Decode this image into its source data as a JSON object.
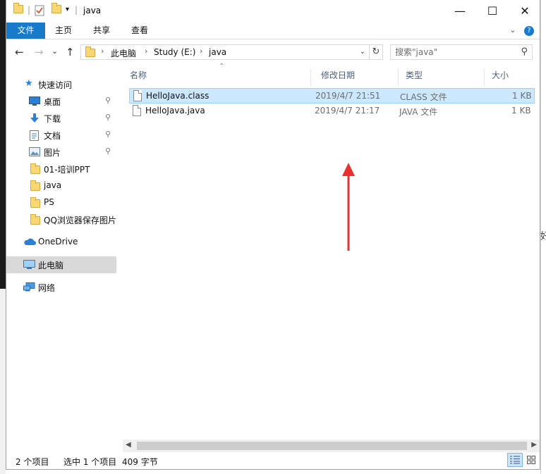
{
  "window": {
    "title": "java",
    "controls": {
      "minimize": "—",
      "maximize": "☐",
      "close": "✕"
    }
  },
  "ribbon": {
    "tabs": [
      "文件",
      "主页",
      "共享",
      "查看"
    ],
    "expand_icon": "chevron-down-icon",
    "help_icon": "help-icon"
  },
  "navigation": {
    "back": "←",
    "forward": "→",
    "recent": "⌄",
    "up": "↑",
    "breadcrumb": [
      "此电脑",
      "Study (E:)",
      "java"
    ],
    "breadcrumb_separator": "›",
    "dropdown": "⌄",
    "refresh": "↻"
  },
  "search": {
    "placeholder": "搜索\"java\"",
    "icon": "search-icon"
  },
  "sidebar": {
    "items": [
      {
        "label": "快速访问",
        "icon": "star-icon"
      },
      {
        "label": "桌面",
        "icon": "desktop-icon",
        "pinned": true
      },
      {
        "label": "下载",
        "icon": "download-icon",
        "pinned": true
      },
      {
        "label": "文档",
        "icon": "document-icon",
        "pinned": true
      },
      {
        "label": "图片",
        "icon": "picture-icon",
        "pinned": true
      },
      {
        "label": "01-培训PPT",
        "icon": "folder-icon"
      },
      {
        "label": "java",
        "icon": "folder-icon"
      },
      {
        "label": "PS",
        "icon": "folder-icon"
      },
      {
        "label": "QQ浏览器保存图片",
        "icon": "folder-icon"
      },
      {
        "label": "OneDrive",
        "icon": "cloud-icon"
      },
      {
        "label": "此电脑",
        "icon": "computer-icon",
        "selected": true
      },
      {
        "label": "网络",
        "icon": "network-icon"
      }
    ],
    "pin_glyph": "📌"
  },
  "file_list": {
    "columns": [
      "名称",
      "修改日期",
      "类型",
      "大小"
    ],
    "sort_indicator": "⌃",
    "rows": [
      {
        "name": "HelloJava.class",
        "modified": "2019/4/7 21:51",
        "type": "CLASS 文件",
        "size": "1 KB",
        "selected": true
      },
      {
        "name": "HelloJava.java",
        "modified": "2019/4/7 21:17",
        "type": "JAVA 文件",
        "size": "1 KB",
        "selected": false
      }
    ]
  },
  "status_bar": {
    "item_count": "2 个项目",
    "selection": "选中 1 个项目",
    "selection_size": "409 字节"
  },
  "background": {
    "right_edge_text": "好"
  },
  "colors": {
    "accent": "#1979ca",
    "selection_bg": "#cce8ff",
    "selection_border": "#99d1ff",
    "annotation_arrow": "#e8312f"
  }
}
